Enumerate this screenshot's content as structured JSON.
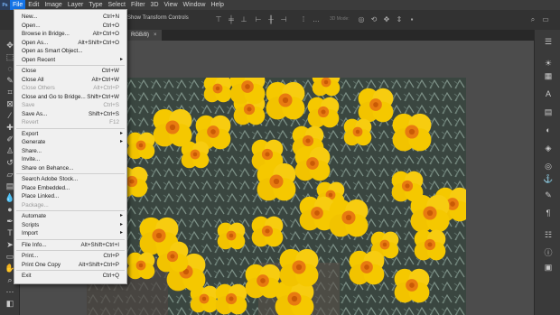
{
  "menubar": {
    "logo": "Ps",
    "items": [
      "File",
      "Edit",
      "Image",
      "Layer",
      "Type",
      "Select",
      "Filter",
      "3D",
      "View",
      "Window",
      "Help"
    ]
  },
  "optbar": {
    "transform_label": "Show Transform Controls",
    "mode_3d": "3D Mode:"
  },
  "tab": {
    "title": "RGB/8)",
    "close": "×"
  },
  "file_menu": [
    {
      "label": "New...",
      "shortcut": "Ctrl+N"
    },
    {
      "label": "Open...",
      "shortcut": "Ctrl+O"
    },
    {
      "label": "Browse in Bridge...",
      "shortcut": "Alt+Ctrl+O"
    },
    {
      "label": "Open As...",
      "shortcut": "Alt+Shift+Ctrl+O"
    },
    {
      "label": "Open as Smart Object...",
      "shortcut": ""
    },
    {
      "label": "Open Recent",
      "shortcut": "",
      "submenu": true
    },
    {
      "label": "Close",
      "shortcut": "Ctrl+W"
    },
    {
      "label": "Close All",
      "shortcut": "Alt+Ctrl+W"
    },
    {
      "label": "Close Others",
      "shortcut": "Alt+Ctrl+P",
      "disabled": true
    },
    {
      "label": "Close and Go to Bridge...",
      "shortcut": "Shift+Ctrl+W"
    },
    {
      "label": "Save",
      "shortcut": "Ctrl+S",
      "disabled": true
    },
    {
      "label": "Save As...",
      "shortcut": "Shift+Ctrl+S"
    },
    {
      "label": "Revert",
      "shortcut": "F12",
      "disabled": true
    },
    {
      "label": "Export",
      "shortcut": "",
      "submenu": true
    },
    {
      "label": "Generate",
      "shortcut": "",
      "submenu": true
    },
    {
      "label": "Share...",
      "shortcut": ""
    },
    {
      "label": "Invite...",
      "shortcut": ""
    },
    {
      "label": "Share on Behance...",
      "shortcut": ""
    },
    {
      "label": "Search Adobe Stock...",
      "shortcut": ""
    },
    {
      "label": "Place Embedded...",
      "shortcut": ""
    },
    {
      "label": "Place Linked...",
      "shortcut": ""
    },
    {
      "label": "Package...",
      "shortcut": "",
      "disabled": true
    },
    {
      "label": "Automate",
      "shortcut": "",
      "submenu": true
    },
    {
      "label": "Scripts",
      "shortcut": "",
      "submenu": true
    },
    {
      "label": "Import",
      "shortcut": "",
      "submenu": true
    },
    {
      "label": "File Info...",
      "shortcut": "Alt+Shift+Ctrl+I"
    },
    {
      "label": "Print...",
      "shortcut": "Ctrl+P"
    },
    {
      "label": "Print One Copy",
      "shortcut": "Alt+Shift+Ctrl+P"
    },
    {
      "label": "Exit",
      "shortcut": "Ctrl+Q"
    }
  ],
  "colors": {
    "menu_highlight": "#1473e6",
    "flower_petal": "#f5c800",
    "flower_center": "#e87a10",
    "foliage": "#3a4640"
  },
  "photo": {
    "subject": "yellow-poppies-photo"
  }
}
